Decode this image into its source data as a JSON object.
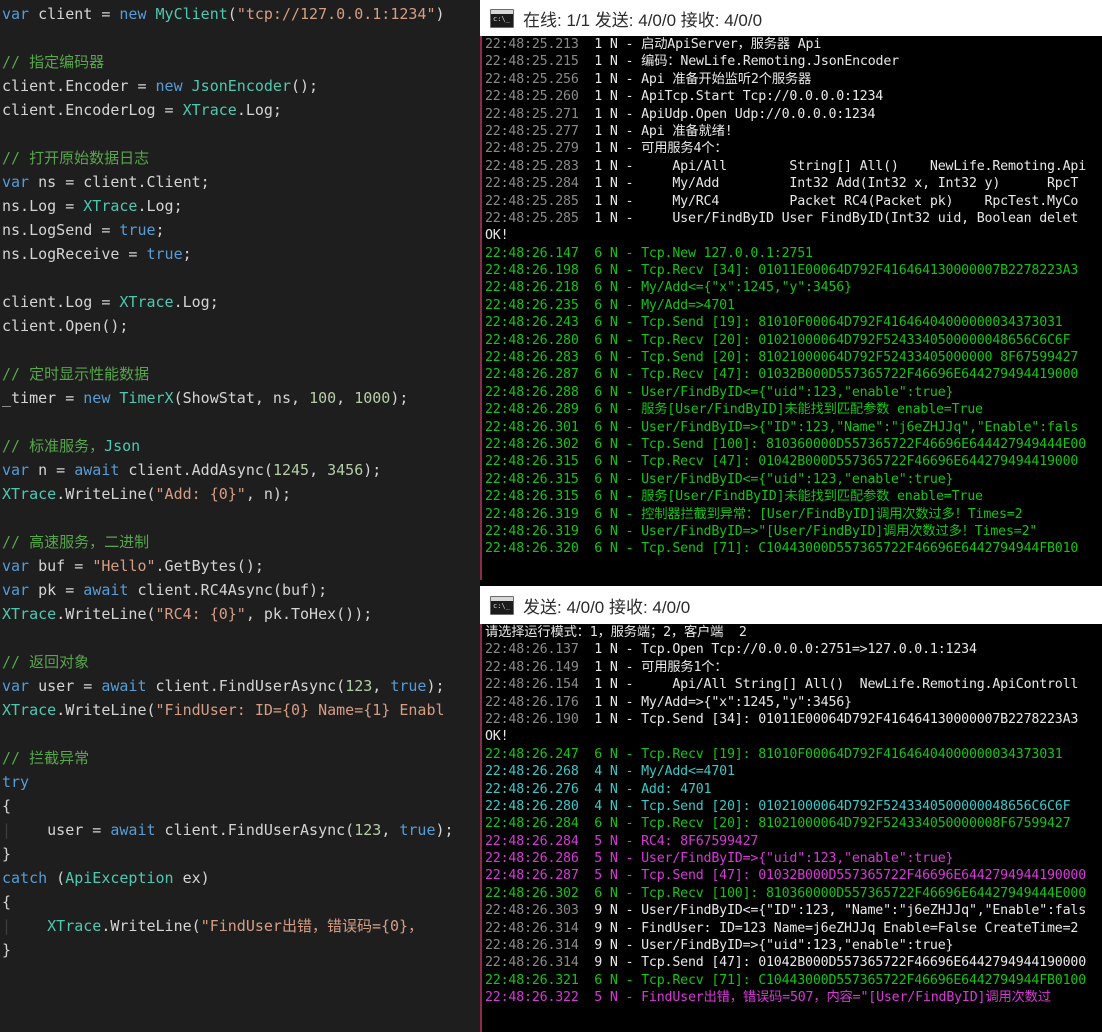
{
  "editor": {
    "name": "code-editor",
    "language": "csharp",
    "lines": [
      [
        [
          "kw",
          "var"
        ],
        [
          "pl",
          " client = "
        ],
        [
          "kw",
          "new"
        ],
        [
          "pl",
          " "
        ],
        [
          "ty",
          "MyClient"
        ],
        [
          "pl",
          "("
        ],
        [
          "st",
          "\"tcp://127.0.0.1:1234\""
        ],
        [
          "pl",
          ")"
        ]
      ],
      [],
      [
        [
          "cm",
          "// 指定编码器"
        ]
      ],
      [
        [
          "pl",
          "client.Encoder = "
        ],
        [
          "kw",
          "new"
        ],
        [
          "pl",
          " "
        ],
        [
          "ty",
          "JsonEncoder"
        ],
        [
          "pl",
          "();"
        ]
      ],
      [
        [
          "pl",
          "client.EncoderLog = "
        ],
        [
          "ty",
          "XTrace"
        ],
        [
          "pl",
          ".Log;"
        ]
      ],
      [],
      [
        [
          "cm",
          "// 打开原始数据日志"
        ]
      ],
      [
        [
          "kw",
          "var"
        ],
        [
          "pl",
          " ns = client.Client;"
        ]
      ],
      [
        [
          "pl",
          "ns.Log = "
        ],
        [
          "ty",
          "XTrace"
        ],
        [
          "pl",
          ".Log;"
        ]
      ],
      [
        [
          "pl",
          "ns.LogSend = "
        ],
        [
          "kw",
          "true"
        ],
        [
          "pl",
          ";"
        ]
      ],
      [
        [
          "pl",
          "ns.LogReceive = "
        ],
        [
          "kw",
          "true"
        ],
        [
          "pl",
          ";"
        ]
      ],
      [],
      [
        [
          "pl",
          "client.Log = "
        ],
        [
          "ty",
          "XTrace"
        ],
        [
          "pl",
          ".Log;"
        ]
      ],
      [
        [
          "pl",
          "client.Open();"
        ]
      ],
      [],
      [
        [
          "cm",
          "// 定时显示性能数据"
        ]
      ],
      [
        [
          "pl",
          "_timer = "
        ],
        [
          "kw",
          "new"
        ],
        [
          "pl",
          " "
        ],
        [
          "ty",
          "TimerX"
        ],
        [
          "pl",
          "(ShowStat, ns, "
        ],
        [
          "nu",
          "100"
        ],
        [
          "pl",
          ", "
        ],
        [
          "nu",
          "1000"
        ],
        [
          "pl",
          ");"
        ]
      ],
      [],
      [
        [
          "cm",
          "// 标准服务，"
        ],
        [
          "ty",
          "Json"
        ]
      ],
      [
        [
          "kw",
          "var"
        ],
        [
          "pl",
          " n = "
        ],
        [
          "kw",
          "await"
        ],
        [
          "pl",
          " client.AddAsync("
        ],
        [
          "nu",
          "1245"
        ],
        [
          "pl",
          ", "
        ],
        [
          "nu",
          "3456"
        ],
        [
          "pl",
          ");"
        ]
      ],
      [
        [
          "ty",
          "XTrace"
        ],
        [
          "pl",
          ".WriteLine("
        ],
        [
          "st",
          "\"Add: {0}\""
        ],
        [
          "pl",
          ", n);"
        ]
      ],
      [],
      [
        [
          "cm",
          "// 高速服务，二进制"
        ]
      ],
      [
        [
          "kw",
          "var"
        ],
        [
          "pl",
          " buf = "
        ],
        [
          "st",
          "\"Hello\""
        ],
        [
          "pl",
          ".GetBytes();"
        ]
      ],
      [
        [
          "kw",
          "var"
        ],
        [
          "pl",
          " pk = "
        ],
        [
          "kw",
          "await"
        ],
        [
          "pl",
          " client.RC4Async(buf);"
        ]
      ],
      [
        [
          "ty",
          "XTrace"
        ],
        [
          "pl",
          ".WriteLine("
        ],
        [
          "st",
          "\"RC4: {0}\""
        ],
        [
          "pl",
          ", pk.ToHex());"
        ]
      ],
      [],
      [
        [
          "cm",
          "// 返回对象"
        ]
      ],
      [
        [
          "kw",
          "var"
        ],
        [
          "pl",
          " user = "
        ],
        [
          "kw",
          "await"
        ],
        [
          "pl",
          " client.FindUserAsync("
        ],
        [
          "nu",
          "123"
        ],
        [
          "pl",
          ", "
        ],
        [
          "kw",
          "true"
        ],
        [
          "pl",
          ");"
        ]
      ],
      [
        [
          "ty",
          "XTrace"
        ],
        [
          "pl",
          ".WriteLine("
        ],
        [
          "st",
          "\"FindUser: ID={0} Name={1} Enabl"
        ]
      ],
      [],
      [
        [
          "cm",
          "// 拦截异常"
        ]
      ],
      [
        [
          "kw",
          "try"
        ]
      ],
      [
        [
          "pl",
          "{"
        ]
      ],
      [
        [
          "guide",
          "|"
        ],
        [
          "pl",
          "    user = "
        ],
        [
          "kw",
          "await"
        ],
        [
          "pl",
          " client.FindUserAsync("
        ],
        [
          "nu",
          "123"
        ],
        [
          "pl",
          ", "
        ],
        [
          "kw",
          "true"
        ],
        [
          "pl",
          ");"
        ]
      ],
      [
        [
          "pl",
          "}"
        ]
      ],
      [
        [
          "kw",
          "catch"
        ],
        [
          "pl",
          " ("
        ],
        [
          "ty",
          "ApiException"
        ],
        [
          "pl",
          " ex)"
        ]
      ],
      [
        [
          "pl",
          "{"
        ]
      ],
      [
        [
          "guide",
          "|"
        ],
        [
          "pl",
          "    "
        ],
        [
          "ty",
          "XTrace"
        ],
        [
          "pl",
          ".WriteLine("
        ],
        [
          "st",
          "\"FindUser出错，错误码={0}，"
        ],
        [
          "pl",
          " "
        ]
      ],
      [
        [
          "pl",
          "}"
        ]
      ]
    ]
  },
  "console_top": {
    "window_name": "server-console",
    "title": "在线: 1/1 发送: 4/0/0 接收: 4/0/0",
    "icon": "cmd-icon",
    "lines": [
      {
        "ts": "22:48:25.213",
        "tscolor": "white",
        "text": "  1 N - 启动ApiServer，服务器 Api",
        "color": "white"
      },
      {
        "ts": "22:48:25.215",
        "tscolor": "white",
        "text": "  1 N - 编码：NewLife.Remoting.JsonEncoder",
        "color": "white"
      },
      {
        "ts": "22:48:25.256",
        "tscolor": "white",
        "text": "  1 N - Api 准备开始监听2个服务器",
        "color": "white"
      },
      {
        "ts": "22:48:25.260",
        "tscolor": "white",
        "text": "  1 N - ApiTcp.Start Tcp://0.0.0.0:1234",
        "color": "white"
      },
      {
        "ts": "22:48:25.271",
        "tscolor": "white",
        "text": "  1 N - ApiUdp.Open Udp://0.0.0.0:1234",
        "color": "white"
      },
      {
        "ts": "22:48:25.277",
        "tscolor": "white",
        "text": "  1 N - Api 准备就绪!",
        "color": "white"
      },
      {
        "ts": "22:48:25.279",
        "tscolor": "white",
        "text": "  1 N - 可用服务4个：",
        "color": "white"
      },
      {
        "ts": "22:48:25.283",
        "tscolor": "white",
        "text": "  1 N -     Api/All        String[] All()    NewLife.Remoting.Api",
        "color": "white"
      },
      {
        "ts": "22:48:25.284",
        "tscolor": "white",
        "text": "  1 N -     My/Add         Int32 Add(Int32 x, Int32 y)      RpcT",
        "color": "white"
      },
      {
        "ts": "22:48:25.285",
        "tscolor": "white",
        "text": "  1 N -     My/RC4         Packet RC4(Packet pk)    RpcTest.MyCo",
        "color": "white"
      },
      {
        "ts": "22:48:25.285",
        "tscolor": "white",
        "text": "  1 N -     User/FindByID User FindByID(Int32 uid, Boolean delet",
        "color": "white"
      },
      {
        "ts": "",
        "tscolor": "white",
        "text": "OK!",
        "color": "white"
      },
      {
        "ts": "22:48:26.147",
        "tscolor": "green",
        "text": "  6 N - Tcp.New 127.0.0.1:2751",
        "color": "green"
      },
      {
        "ts": "22:48:26.198",
        "tscolor": "green",
        "text": "  6 N - Tcp.Recv [34]: 01011E00064D792F416464130000007B2278223A3",
        "color": "green"
      },
      {
        "ts": "22:48:26.218",
        "tscolor": "green",
        "text": "  6 N - My/Add<={\"x\":1245,\"y\":3456}",
        "color": "green"
      },
      {
        "ts": "22:48:26.235",
        "tscolor": "green",
        "text": "  6 N - My/Add=>4701",
        "color": "green"
      },
      {
        "ts": "22:48:26.243",
        "tscolor": "green",
        "text": "  6 N - Tcp.Send [19]: 81010F00064D792F41646404000000034373031",
        "color": "green"
      },
      {
        "ts": "22:48:26.280",
        "tscolor": "green",
        "text": "  6 N - Tcp.Recv [20]: 01021000064D792F5243340500000048656C6C6F",
        "color": "green"
      },
      {
        "ts": "22:48:26.283",
        "tscolor": "green",
        "text": "  6 N - Tcp.Send [20]: 81021000064D792F52433405000000 8F67599427",
        "color": "green"
      },
      {
        "ts": "22:48:26.287",
        "tscolor": "green",
        "text": "  6 N - Tcp.Recv [47]: 01032B000D557365722F46696E644279494419000",
        "color": "green"
      },
      {
        "ts": "22:48:26.288",
        "tscolor": "green",
        "text": "  6 N - User/FindByID<={\"uid\":123,\"enable\":true}",
        "color": "green"
      },
      {
        "ts": "22:48:26.289",
        "tscolor": "green",
        "text": "  6 N - 服务[User/FindByID]未能找到匹配参数 enable=True",
        "color": "green"
      },
      {
        "ts": "22:48:26.301",
        "tscolor": "green",
        "text": "  6 N - User/FindByID=>{\"ID\":123,\"Name\":\"j6eZHJJq\",\"Enable\":fals",
        "color": "green"
      },
      {
        "ts": "22:48:26.302",
        "tscolor": "green",
        "text": "  6 N - Tcp.Send [100]: 810360000D557365722F46696E644427949444E00",
        "color": "green"
      },
      {
        "ts": "22:48:26.315",
        "tscolor": "green",
        "text": "  6 N - Tcp.Recv [47]: 01042B000D557365722F46696E644279494419000",
        "color": "green"
      },
      {
        "ts": "22:48:26.315",
        "tscolor": "green",
        "text": "  6 N - User/FindByID<={\"uid\":123,\"enable\":true}",
        "color": "green"
      },
      {
        "ts": "22:48:26.315",
        "tscolor": "green",
        "text": "  6 N - 服务[User/FindByID]未能找到匹配参数 enable=True",
        "color": "green"
      },
      {
        "ts": "22:48:26.319",
        "tscolor": "green",
        "text": "  6 N - 控制器拦截到异常：[User/FindByID]调用次数过多！Times=2",
        "color": "green"
      },
      {
        "ts": "22:48:26.319",
        "tscolor": "green",
        "text": "  6 N - User/FindByID=>\"[User/FindByID]调用次数过多！Times=2\"",
        "color": "green"
      },
      {
        "ts": "22:48:26.320",
        "tscolor": "green",
        "text": "  6 N - Tcp.Send [71]: C10443000D557365722F46696E6442794944FB010",
        "color": "green"
      }
    ]
  },
  "console_bottom": {
    "window_name": "client-console",
    "title": "发送: 4/0/0 接收: 4/0/0",
    "icon": "cmd-icon",
    "lines": [
      {
        "ts": "",
        "tscolor": "white",
        "text": "请选择运行模式：1，服务端；2，客户端  2",
        "color": "white"
      },
      {
        "ts": "22:48:26.137",
        "tscolor": "white",
        "text": "  1 N - Tcp.Open Tcp://0.0.0.0:2751=>127.0.0.1:1234",
        "color": "white"
      },
      {
        "ts": "22:48:26.149",
        "tscolor": "white",
        "text": "  1 N - 可用服务1个：",
        "color": "white"
      },
      {
        "ts": "22:48:26.154",
        "tscolor": "white",
        "text": "  1 N -     Api/All String[] All()  NewLife.Remoting.ApiControll",
        "color": "white"
      },
      {
        "ts": "22:48:26.176",
        "tscolor": "white",
        "text": "  1 N - My/Add=>{\"x\":1245,\"y\":3456}",
        "color": "white"
      },
      {
        "ts": "22:48:26.190",
        "tscolor": "white",
        "text": "  1 N - Tcp.Send [34]: 01011E00064D792F416464130000007B2278223A3",
        "color": "white"
      },
      {
        "ts": "",
        "tscolor": "white",
        "text": "OK!",
        "color": "white"
      },
      {
        "ts": "22:48:26.247",
        "tscolor": "green",
        "text": "  6 N - Tcp.Recv [19]: 81010F00064D792F41646404000000034373031",
        "color": "green"
      },
      {
        "ts": "22:48:26.268",
        "tscolor": "cyan",
        "text": "  4 N - My/Add<=4701",
        "color": "cyan"
      },
      {
        "ts": "22:48:26.276",
        "tscolor": "cyan",
        "text": "  4 N - Add: 4701",
        "color": "cyan"
      },
      {
        "ts": "22:48:26.280",
        "tscolor": "cyan",
        "text": "  4 N - Tcp.Send [20]: 01021000064D792F5243340500000048656C6C6F",
        "color": "cyan"
      },
      {
        "ts": "22:48:26.284",
        "tscolor": "green",
        "text": "  6 N - Tcp.Recv [20]: 81021000064D792F524334050000008F67599427",
        "color": "green"
      },
      {
        "ts": "22:48:26.284",
        "tscolor": "mag",
        "text": "  5 N - RC4: 8F67599427",
        "color": "mag"
      },
      {
        "ts": "22:48:26.286",
        "tscolor": "mag",
        "text": "  5 N - User/FindByID=>{\"uid\":123,\"enable\":true}",
        "color": "mag"
      },
      {
        "ts": "22:48:26.287",
        "tscolor": "mag",
        "text": "  5 N - Tcp.Send [47]: 01032B000D557365722F46696E6442794944190000",
        "color": "mag"
      },
      {
        "ts": "22:48:26.302",
        "tscolor": "green",
        "text": "  6 N - Tcp.Recv [100]: 810360000D557365722F46696E64427949444E000",
        "color": "green"
      },
      {
        "ts": "22:48:26.303",
        "tscolor": "white",
        "text": "  9 N - User/FindByID<={\"ID\":123, \"Name\":\"j6eZHJJq\",\"Enable\":fals",
        "color": "white"
      },
      {
        "ts": "22:48:26.314",
        "tscolor": "white",
        "text": "  9 N - FindUser: ID=123 Name=j6eZHJJq Enable=False CreateTime=2",
        "color": "white"
      },
      {
        "ts": "22:48:26.314",
        "tscolor": "white",
        "text": "  9 N - User/FindByID=>{\"uid\":123,\"enable\":true}",
        "color": "white"
      },
      {
        "ts": "22:48:26.314",
        "tscolor": "white",
        "text": "  9 N - Tcp.Send [47]: 01042B000D557365722F46696E6442794944190000",
        "color": "white"
      },
      {
        "ts": "22:48:26.321",
        "tscolor": "green",
        "text": "  6 N - Tcp.Recv [71]: C10443000D557365722F46696E6442794944FB0100",
        "color": "green"
      },
      {
        "ts": "22:48:26.322",
        "tscolor": "mag",
        "text": "  5 N - FindUser出错，错误码=507，内容=\"[User/FindByID]调用次数过",
        "color": "mag"
      }
    ]
  }
}
